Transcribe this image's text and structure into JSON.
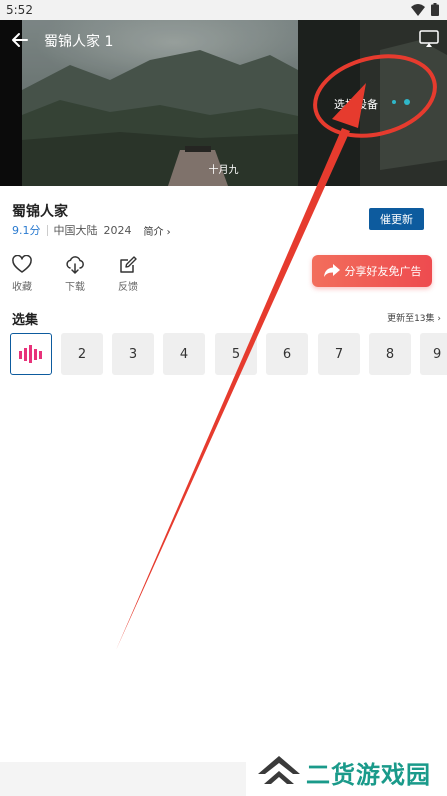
{
  "status_bar": {
    "time": "5:52"
  },
  "player": {
    "title": "蜀锦人家 1",
    "cast_label": "选择设备",
    "subtitle": "十月九"
  },
  "show": {
    "title": "蜀锦人家",
    "rating": "9.1分",
    "region": "中国大陆",
    "year": "2024",
    "intro_label": "简介 ›"
  },
  "urge_button": "催更新",
  "actions": [
    {
      "label": "收藏",
      "icon": "heart-icon"
    },
    {
      "label": "下载",
      "icon": "cloud-download-icon"
    },
    {
      "label": "反馈",
      "icon": "edit-icon"
    }
  ],
  "share_button": "分享好友免广告",
  "episodes": {
    "title": "选集",
    "update_info": "更新至13集 ›",
    "items": [
      "2",
      "3",
      "4",
      "5",
      "6",
      "7",
      "8",
      "9"
    ]
  },
  "watermark": "二货游戏园",
  "colors": {
    "accent_blue": "#0d5b9e",
    "rating_blue": "#2b7bd0",
    "share_red": "#ee4b4f",
    "playing_pink": "#e8327a",
    "annotation_red": "#e63b2e"
  }
}
